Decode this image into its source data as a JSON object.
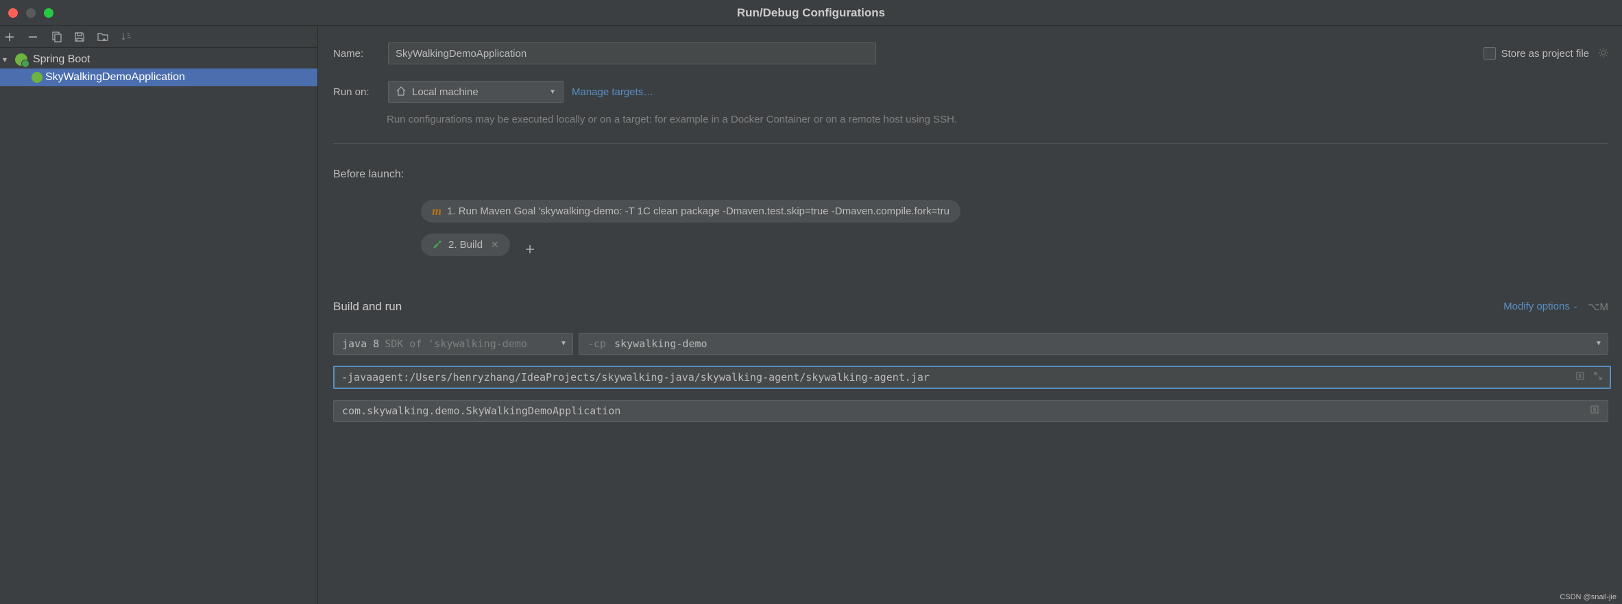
{
  "title": "Run/Debug Configurations",
  "sidebar": {
    "group_label": "Spring Boot",
    "item_label": "SkyWalkingDemoApplication"
  },
  "form": {
    "name_label": "Name:",
    "name_value": "SkyWalkingDemoApplication",
    "store_label": "Store as project file",
    "run_on_label": "Run on:",
    "run_on_value": "Local machine",
    "manage_targets": "Manage targets…",
    "help_text": "Run configurations may be executed locally or on a target: for example in a Docker Container or on a remote host using SSH."
  },
  "before_launch": {
    "label": "Before launch:",
    "items": [
      "1. Run Maven Goal 'skywalking-demo: -T 1C clean package -Dmaven.test.skip=true -Dmaven.compile.fork=tru",
      "2. Build"
    ]
  },
  "build_run": {
    "label": "Build and run",
    "modify_options": "Modify options",
    "shortcut": "⌥M",
    "jdk_name": "java 8",
    "jdk_desc": "SDK of 'skywalking-demo",
    "cp_prefix": "-cp",
    "cp_value": "skywalking-demo",
    "vm_options": "-javaagent:/Users/henryzhang/IdeaProjects/skywalking-java/skywalking-agent/skywalking-agent.jar",
    "main_class": "com.skywalking.demo.SkyWalkingDemoApplication"
  },
  "watermark": "CSDN @snail-jie"
}
